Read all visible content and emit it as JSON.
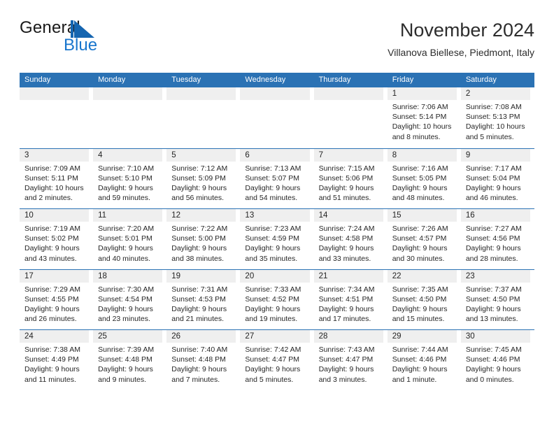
{
  "brand": {
    "name_part1": "General",
    "name_part2": "Blue",
    "mark_name": "blue-triangle-logo",
    "color_dark": "#1565b0",
    "color_light": "#1976cd"
  },
  "header": {
    "title": "November 2024",
    "subtitle": "Villanova Biellese, Piedmont, Italy"
  },
  "colors": {
    "header_band": "#2b72b4",
    "row_divider": "#2b72b4",
    "day_band": "#efefef",
    "text": "#262626"
  },
  "weekdays": [
    "Sunday",
    "Monday",
    "Tuesday",
    "Wednesday",
    "Thursday",
    "Friday",
    "Saturday"
  ],
  "weeks": [
    [
      {
        "day": "",
        "lines": []
      },
      {
        "day": "",
        "lines": []
      },
      {
        "day": "",
        "lines": []
      },
      {
        "day": "",
        "lines": []
      },
      {
        "day": "",
        "lines": []
      },
      {
        "day": "1",
        "lines": [
          "Sunrise: 7:06 AM",
          "Sunset: 5:14 PM",
          "Daylight: 10 hours",
          "and 8 minutes."
        ]
      },
      {
        "day": "2",
        "lines": [
          "Sunrise: 7:08 AM",
          "Sunset: 5:13 PM",
          "Daylight: 10 hours",
          "and 5 minutes."
        ]
      }
    ],
    [
      {
        "day": "3",
        "lines": [
          "Sunrise: 7:09 AM",
          "Sunset: 5:11 PM",
          "Daylight: 10 hours",
          "and 2 minutes."
        ]
      },
      {
        "day": "4",
        "lines": [
          "Sunrise: 7:10 AM",
          "Sunset: 5:10 PM",
          "Daylight: 9 hours",
          "and 59 minutes."
        ]
      },
      {
        "day": "5",
        "lines": [
          "Sunrise: 7:12 AM",
          "Sunset: 5:09 PM",
          "Daylight: 9 hours",
          "and 56 minutes."
        ]
      },
      {
        "day": "6",
        "lines": [
          "Sunrise: 7:13 AM",
          "Sunset: 5:07 PM",
          "Daylight: 9 hours",
          "and 54 minutes."
        ]
      },
      {
        "day": "7",
        "lines": [
          "Sunrise: 7:15 AM",
          "Sunset: 5:06 PM",
          "Daylight: 9 hours",
          "and 51 minutes."
        ]
      },
      {
        "day": "8",
        "lines": [
          "Sunrise: 7:16 AM",
          "Sunset: 5:05 PM",
          "Daylight: 9 hours",
          "and 48 minutes."
        ]
      },
      {
        "day": "9",
        "lines": [
          "Sunrise: 7:17 AM",
          "Sunset: 5:04 PM",
          "Daylight: 9 hours",
          "and 46 minutes."
        ]
      }
    ],
    [
      {
        "day": "10",
        "lines": [
          "Sunrise: 7:19 AM",
          "Sunset: 5:02 PM",
          "Daylight: 9 hours",
          "and 43 minutes."
        ]
      },
      {
        "day": "11",
        "lines": [
          "Sunrise: 7:20 AM",
          "Sunset: 5:01 PM",
          "Daylight: 9 hours",
          "and 40 minutes."
        ]
      },
      {
        "day": "12",
        "lines": [
          "Sunrise: 7:22 AM",
          "Sunset: 5:00 PM",
          "Daylight: 9 hours",
          "and 38 minutes."
        ]
      },
      {
        "day": "13",
        "lines": [
          "Sunrise: 7:23 AM",
          "Sunset: 4:59 PM",
          "Daylight: 9 hours",
          "and 35 minutes."
        ]
      },
      {
        "day": "14",
        "lines": [
          "Sunrise: 7:24 AM",
          "Sunset: 4:58 PM",
          "Daylight: 9 hours",
          "and 33 minutes."
        ]
      },
      {
        "day": "15",
        "lines": [
          "Sunrise: 7:26 AM",
          "Sunset: 4:57 PM",
          "Daylight: 9 hours",
          "and 30 minutes."
        ]
      },
      {
        "day": "16",
        "lines": [
          "Sunrise: 7:27 AM",
          "Sunset: 4:56 PM",
          "Daylight: 9 hours",
          "and 28 minutes."
        ]
      }
    ],
    [
      {
        "day": "17",
        "lines": [
          "Sunrise: 7:29 AM",
          "Sunset: 4:55 PM",
          "Daylight: 9 hours",
          "and 26 minutes."
        ]
      },
      {
        "day": "18",
        "lines": [
          "Sunrise: 7:30 AM",
          "Sunset: 4:54 PM",
          "Daylight: 9 hours",
          "and 23 minutes."
        ]
      },
      {
        "day": "19",
        "lines": [
          "Sunrise: 7:31 AM",
          "Sunset: 4:53 PM",
          "Daylight: 9 hours",
          "and 21 minutes."
        ]
      },
      {
        "day": "20",
        "lines": [
          "Sunrise: 7:33 AM",
          "Sunset: 4:52 PM",
          "Daylight: 9 hours",
          "and 19 minutes."
        ]
      },
      {
        "day": "21",
        "lines": [
          "Sunrise: 7:34 AM",
          "Sunset: 4:51 PM",
          "Daylight: 9 hours",
          "and 17 minutes."
        ]
      },
      {
        "day": "22",
        "lines": [
          "Sunrise: 7:35 AM",
          "Sunset: 4:50 PM",
          "Daylight: 9 hours",
          "and 15 minutes."
        ]
      },
      {
        "day": "23",
        "lines": [
          "Sunrise: 7:37 AM",
          "Sunset: 4:50 PM",
          "Daylight: 9 hours",
          "and 13 minutes."
        ]
      }
    ],
    [
      {
        "day": "24",
        "lines": [
          "Sunrise: 7:38 AM",
          "Sunset: 4:49 PM",
          "Daylight: 9 hours",
          "and 11 minutes."
        ]
      },
      {
        "day": "25",
        "lines": [
          "Sunrise: 7:39 AM",
          "Sunset: 4:48 PM",
          "Daylight: 9 hours",
          "and 9 minutes."
        ]
      },
      {
        "day": "26",
        "lines": [
          "Sunrise: 7:40 AM",
          "Sunset: 4:48 PM",
          "Daylight: 9 hours",
          "and 7 minutes."
        ]
      },
      {
        "day": "27",
        "lines": [
          "Sunrise: 7:42 AM",
          "Sunset: 4:47 PM",
          "Daylight: 9 hours",
          "and 5 minutes."
        ]
      },
      {
        "day": "28",
        "lines": [
          "Sunrise: 7:43 AM",
          "Sunset: 4:47 PM",
          "Daylight: 9 hours",
          "and 3 minutes."
        ]
      },
      {
        "day": "29",
        "lines": [
          "Sunrise: 7:44 AM",
          "Sunset: 4:46 PM",
          "Daylight: 9 hours",
          "and 1 minute."
        ]
      },
      {
        "day": "30",
        "lines": [
          "Sunrise: 7:45 AM",
          "Sunset: 4:46 PM",
          "Daylight: 9 hours",
          "and 0 minutes."
        ]
      }
    ]
  ]
}
